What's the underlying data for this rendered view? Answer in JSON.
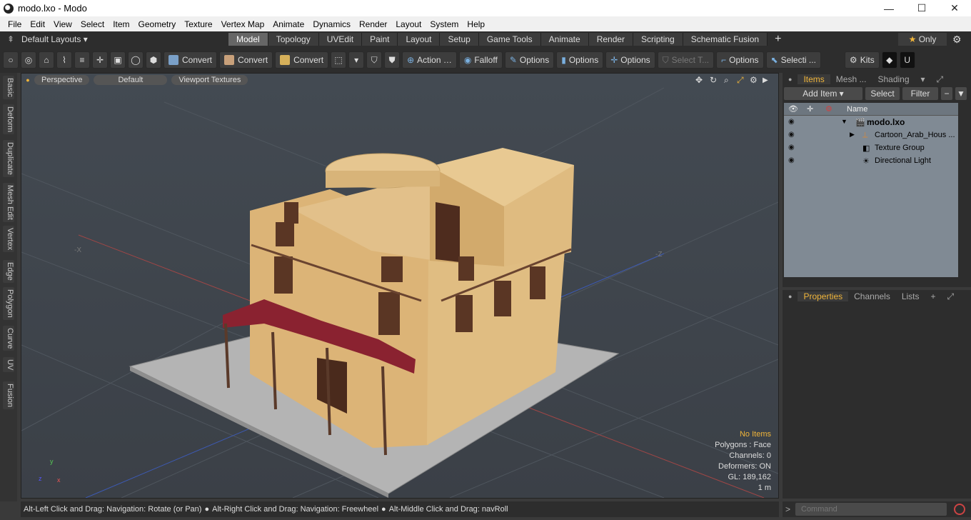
{
  "window": {
    "title": "modo.lxo - Modo",
    "minimize": "—",
    "maximize": "☐",
    "close": "✕"
  },
  "menu": [
    "File",
    "Edit",
    "View",
    "Select",
    "Item",
    "Geometry",
    "Texture",
    "Vertex Map",
    "Animate",
    "Dynamics",
    "Render",
    "Layout",
    "System",
    "Help"
  ],
  "layouts": {
    "label": "Default Layouts",
    "tabs": [
      "Model",
      "Topology",
      "UVEdit",
      "Paint",
      "Layout",
      "Setup",
      "Game Tools",
      "Animate",
      "Render",
      "Scripting",
      "Schematic Fusion"
    ],
    "active": "Model",
    "add": "+",
    "only": "Only"
  },
  "toolbar": {
    "convert1": "Convert",
    "convert2": "Convert",
    "convert3": "Convert",
    "action": "Action",
    "falloff": "Falloff",
    "options1": "Options",
    "options2": "Options",
    "options3": "Options",
    "select": "Select T...",
    "options4": "Options",
    "selecti": "Selecti ...",
    "kits": "Kits"
  },
  "lefttabs": [
    "Basic",
    "Deform",
    "Duplicate",
    "Mesh Edit",
    "Vertex",
    "Edge",
    "Polygon",
    "Curve",
    "UV",
    "Fusion"
  ],
  "viewport": {
    "view": "Perspective",
    "style": "Default",
    "textures": "Viewport Textures",
    "axis_x": "-X",
    "axis_z": "-Z",
    "status": {
      "items": "No Items",
      "polygons": "Polygons : Face",
      "channels": "Channels: 0",
      "deformers": "Deformers: ON",
      "gl": "GL: 189,162",
      "unit": "1 m"
    }
  },
  "statusbar": {
    "hint1": "Alt-Left Click and Drag: Navigation: Rotate (or Pan)",
    "hint2": "Alt-Right Click and Drag: Navigation: Freewheel",
    "hint3": "Alt-Middle Click and Drag: navRoll"
  },
  "items_panel": {
    "tabs": [
      "Items",
      "Mesh ...",
      "Shading"
    ],
    "add_item": "Add Item",
    "select": "Select",
    "filter": "Filter",
    "col_name": "Name",
    "rows": [
      {
        "label": "modo.lxo",
        "bold": true
      },
      {
        "label": "Cartoon_Arab_Hous ..."
      },
      {
        "label": "Texture Group"
      },
      {
        "label": "Directional Light"
      }
    ]
  },
  "properties_panel": {
    "tabs": [
      "Properties",
      "Channels",
      "Lists"
    ]
  },
  "command": {
    "placeholder": "Command"
  }
}
